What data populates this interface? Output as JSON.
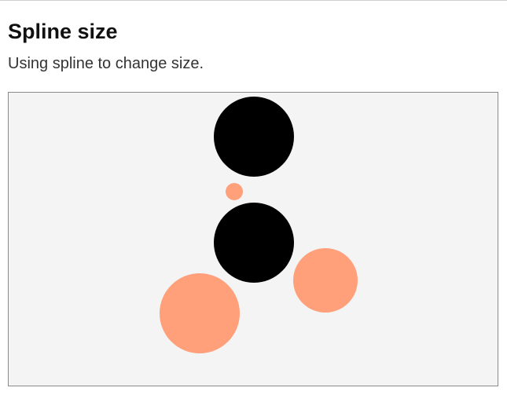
{
  "page": {
    "title": "Spline size",
    "subtitle": "Using spline to change size."
  },
  "colors": {
    "control_point": "#000000",
    "animated_shape": "#ffa07a",
    "stage_background": "#f4f4f4",
    "stage_border": "#8a8a8a"
  },
  "stage": {
    "control_points": [
      "control-point-1",
      "control-point-2"
    ],
    "animated_shapes": [
      "animated-circle-1",
      "animated-circle-2",
      "animated-circle-3",
      "animated-circle-4"
    ]
  }
}
